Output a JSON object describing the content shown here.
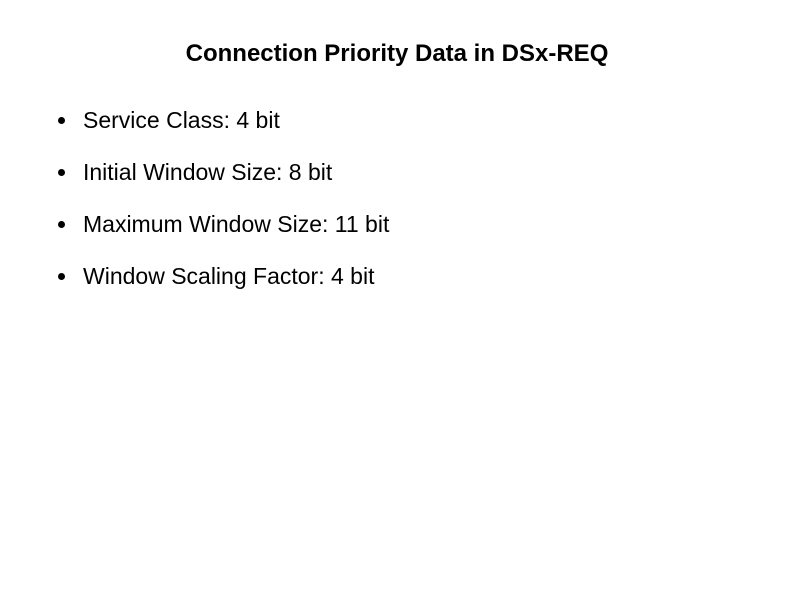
{
  "slide": {
    "title": "Connection Priority Data in DSx-REQ",
    "bullets": [
      "Service Class: 4 bit",
      "Initial Window Size: 8 bit",
      "Maximum Window Size: 11 bit",
      "Window Scaling Factor: 4 bit"
    ]
  }
}
